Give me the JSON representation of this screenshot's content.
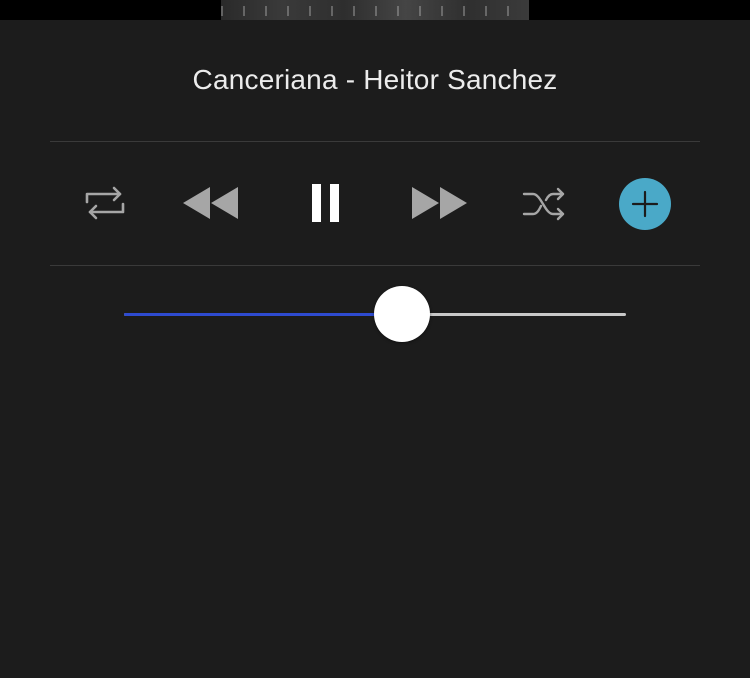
{
  "player": {
    "track_title": "Canceriana - Heitor Sanchez",
    "progress": 0.553,
    "accent_color": "#4aa9c8",
    "progress_color": "#2e4bd0"
  },
  "controls": {
    "repeat_icon": "repeat-icon",
    "rewind_icon": "rewind-icon",
    "pause_icon": "pause-icon",
    "forward_icon": "fast-forward-icon",
    "shuffle_icon": "shuffle-icon",
    "add_icon": "plus-icon"
  }
}
